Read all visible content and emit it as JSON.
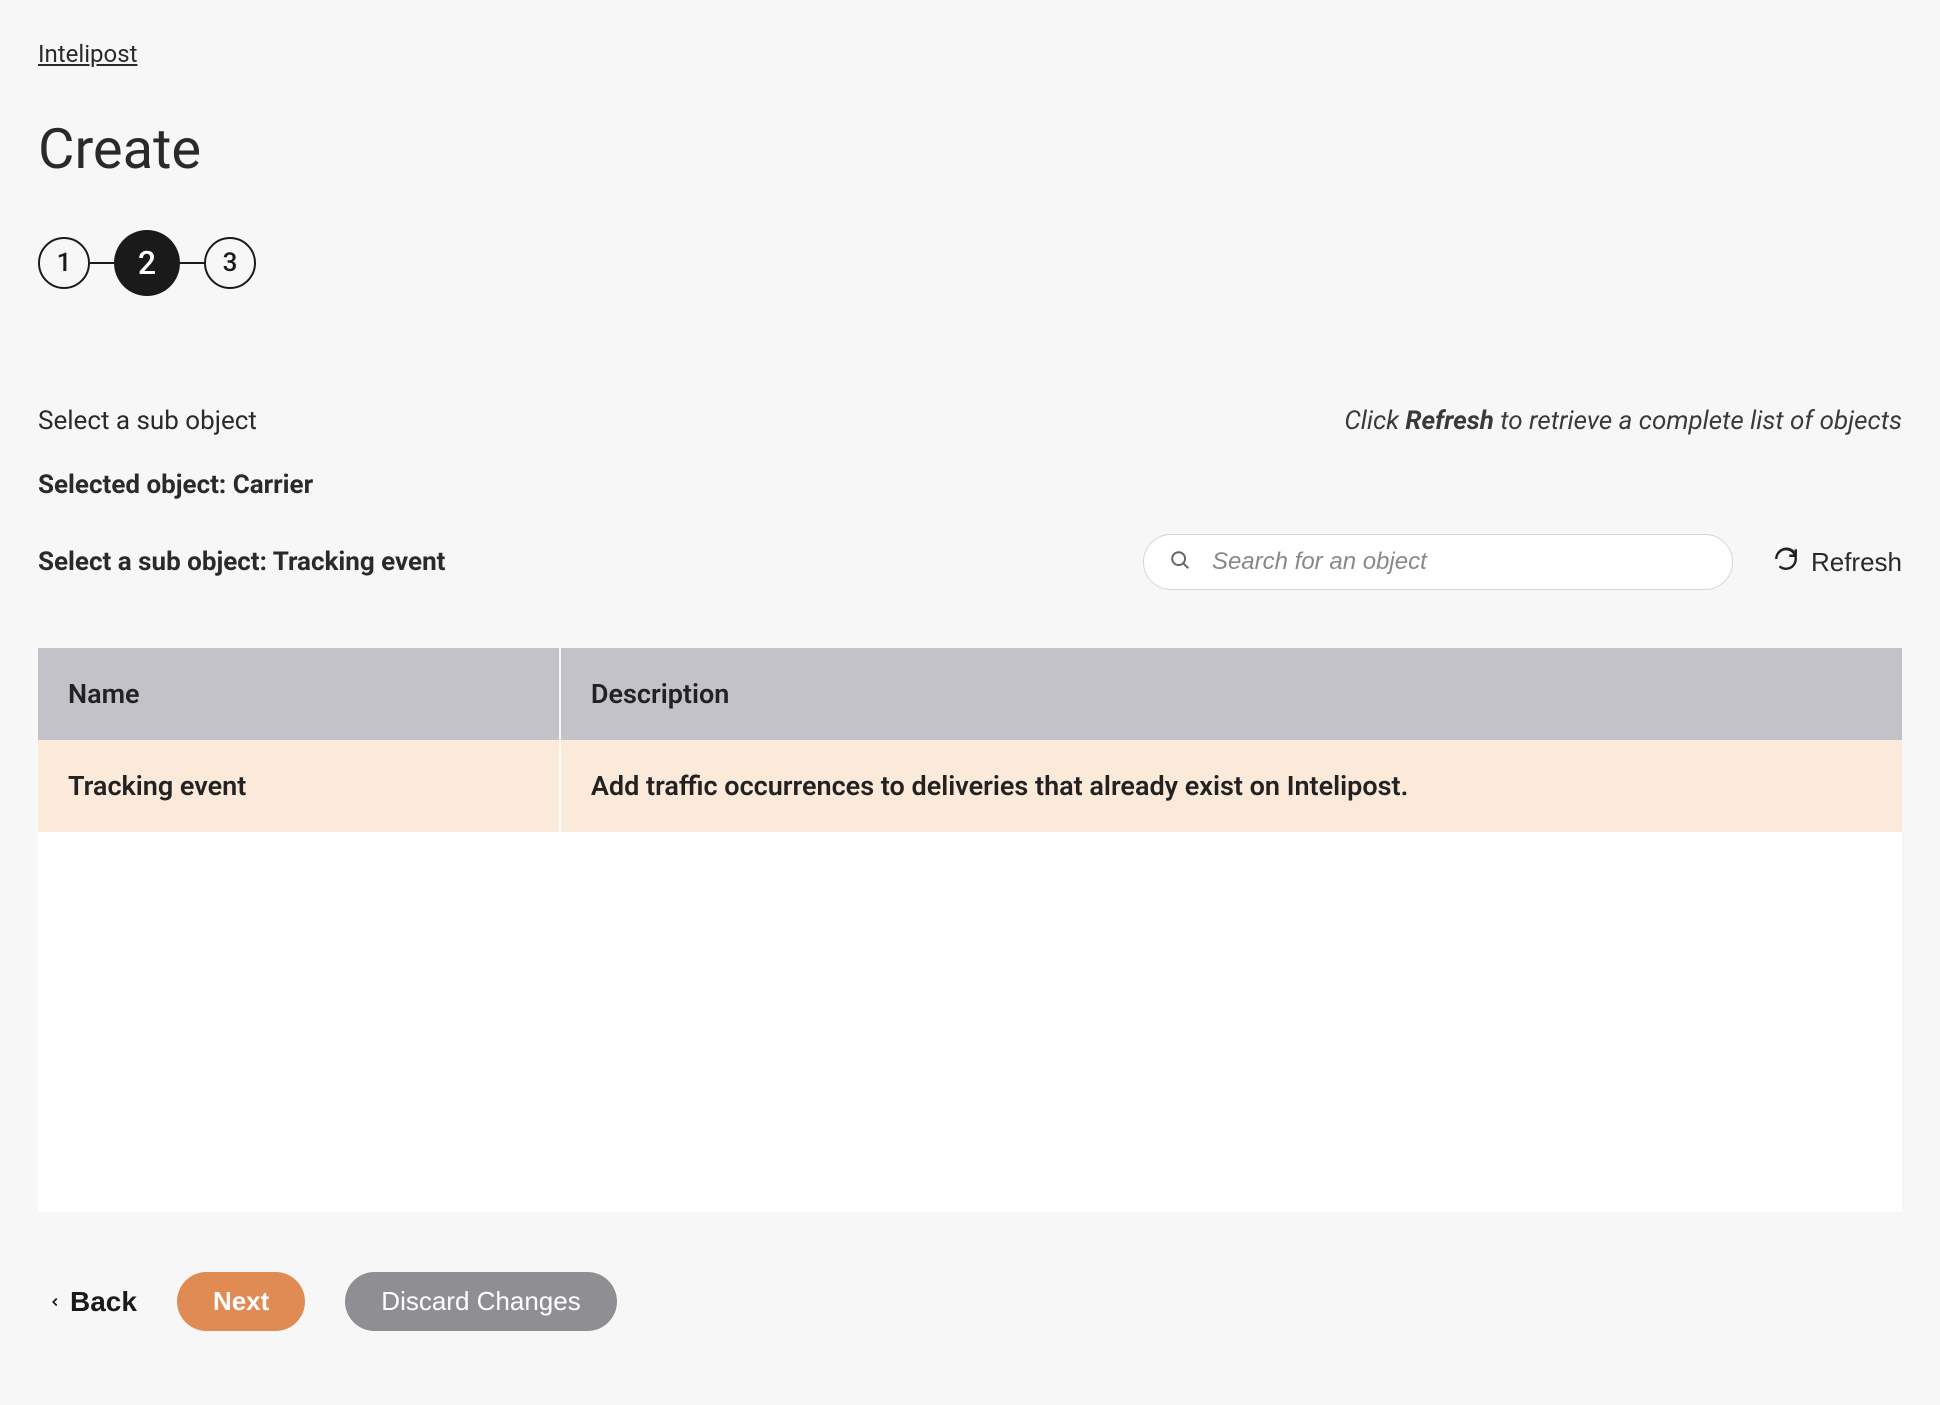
{
  "breadcrumb": "Intelipost",
  "title": "Create",
  "steps": [
    "1",
    "2",
    "3"
  ],
  "active_step_index": 1,
  "info": {
    "select_label": "Select a sub object",
    "hint_prefix": "Click ",
    "hint_strong": "Refresh",
    "hint_suffix": " to retrieve a complete list of objects"
  },
  "selected_object_line": "Selected object: Carrier",
  "sub_object_line": "Select a sub object: Tracking event",
  "search": {
    "placeholder": "Search for an object"
  },
  "refresh_label": "Refresh",
  "table": {
    "columns": {
      "name": "Name",
      "description": "Description"
    },
    "rows": [
      {
        "name": "Tracking event",
        "description": "Add traffic occurrences to deliveries that already exist on Intelipost."
      }
    ]
  },
  "footer": {
    "back": "Back",
    "next": "Next",
    "discard": "Discard Changes"
  }
}
